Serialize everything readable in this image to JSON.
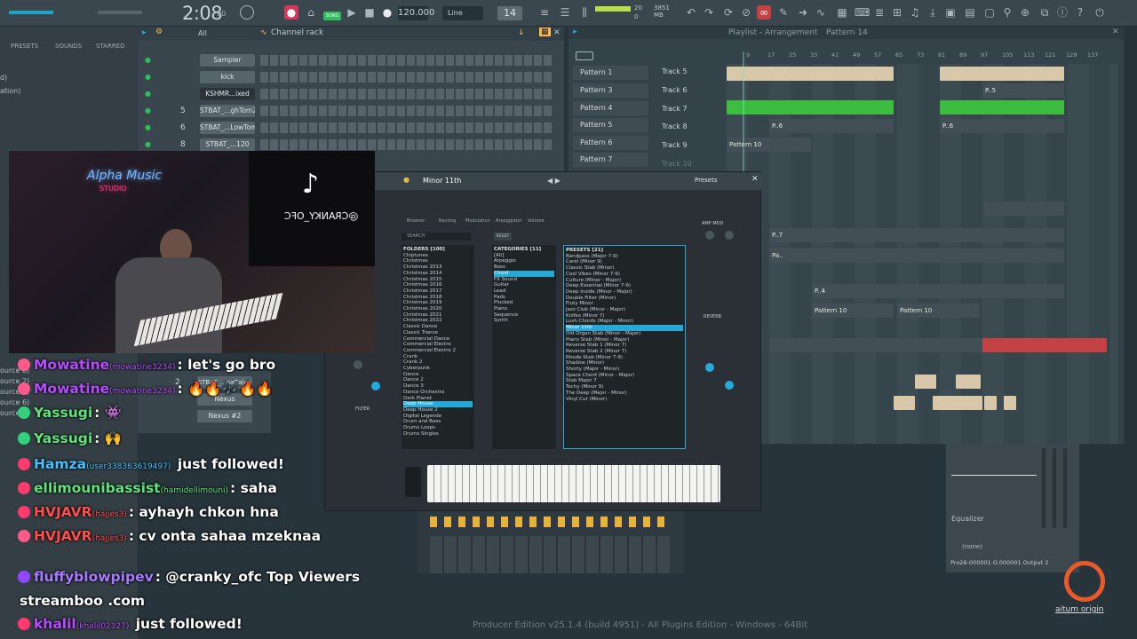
{
  "toolbar": {
    "time": "2:08",
    "time_sub": "00",
    "song_label": "SONG",
    "tempo": "120.000",
    "snap": "Line",
    "steps": "14",
    "cpu": "20",
    "memory": "3851 MB",
    "cpu_row2": "0"
  },
  "browser": {
    "tabs": [
      "PRESETS",
      "SOUNDS",
      "STARRED"
    ],
    "left_items": [
      "d)",
      "ation)",
      "ource 6)",
      "ource 2)",
      "ource 1)",
      "ource 6)",
      "ource 7)"
    ]
  },
  "channel_rack": {
    "filter": "All",
    "title": "Channel rack",
    "channels": [
      {
        "num": "",
        "name": "Sampler"
      },
      {
        "num": "",
        "name": "kick"
      },
      {
        "num": "",
        "name": "KSHMR...ixed"
      },
      {
        "num": "5",
        "name": "STBAT_...ghTom2"
      },
      {
        "num": "6",
        "name": "STBAT_...LowTom"
      },
      {
        "num": "8",
        "name": "STBAT_...120"
      },
      {
        "num": "2",
        "name": "STBAT_...naCajon"
      },
      {
        "num": "",
        "name": "Nexus"
      },
      {
        "num": "",
        "name": "Nexus #2"
      }
    ]
  },
  "playlist": {
    "title": "Playlist - Arrangement",
    "pattern": "Pattern 14",
    "patterns": [
      "Pattern 1",
      "Pattern 3",
      "Pattern 4",
      "Pattern 5",
      "Pattern 6",
      "Pattern 7"
    ],
    "tracks": [
      "Track 5",
      "Track 6",
      "Track 7",
      "Track 8",
      "Track 9",
      "Track 10"
    ],
    "ruler": [
      "9",
      "17",
      "25",
      "33",
      "41",
      "49",
      "57",
      "65",
      "73",
      "81",
      "89",
      "97",
      "105",
      "113",
      "121",
      "129",
      "137"
    ],
    "clip_labels": {
      "p5": "P..5",
      "p6": "P..6",
      "pattern10": "Pattern 10",
      "p7": "P..7",
      "pa": "Pa..",
      "p4": "P..4"
    }
  },
  "plugin": {
    "preset": "Minor 11th",
    "presets_label": "Presets",
    "tabs": [
      "Browser",
      "Routing",
      "Modulation",
      "Arpeggiator",
      "Volume"
    ],
    "folders_title": "FOLDERS [100]",
    "folders": [
      "Chiptunes",
      "Christmas",
      "Christmas 2013",
      "Christmas 2014",
      "Christmas 2015",
      "Christmas 2016",
      "Christmas 2017",
      "Christmas 2018",
      "Christmas 2019",
      "Christmas 2020",
      "Christmas 2021",
      "Christmas 2022",
      "Classic Dance",
      "Classic Trance",
      "Commercial Dance",
      "Commercial Electro",
      "Commercial Electro 2",
      "Crank",
      "Crank 2",
      "Cyberpunk",
      "Dance",
      "Dance 2",
      "Dance 3",
      "Dance Orchestra",
      "Dark Planet",
      "Deep House",
      "Deep House 2",
      "Digital Legende",
      "Drum and Bass",
      "Drums Loops",
      "Drums Singles"
    ],
    "categories_title": "CATEGORIES [11]",
    "categories": [
      "[All]",
      "Arpeggio",
      "Bass",
      "Chord",
      "FX Sound",
      "Guitar",
      "Lead",
      "Pads",
      "Plucked",
      "Piano",
      "Sequence",
      "Synth"
    ],
    "presets_title": "PRESETS [21]",
    "presets": [
      "Bandpass (Major 7-9)",
      "Carol (Minor 9)",
      "Classic Stab (Minor)",
      "Cool Vibes (Minor 7-9)",
      "Culture (Minor - Major)",
      "Deep Essential (Minor 7-9)",
      "Deep Inside (Minor - Major)",
      "Double Filter (Minor)",
      "Fluty Minor",
      "Jazz Club (Minor - Major)",
      "Knifes (Minor 7)",
      "Lush Chords (Major - Minor)",
      "Minor 11th",
      "Old Organ Stab (Minor - Major)",
      "Piano Stab (Minor - Major)",
      "Reverse Stab 1 (Minor 7)",
      "Reverse Stab 2 (Minor 7)",
      "Rhode Stab (Minor 7-9)",
      "Shadow (Minor)",
      "Shorty (Major - Minor)",
      "Space Chord (Minor - Major)",
      "Stab Major 7",
      "Techy (Minor 9)",
      "The Deep (Major - Minor)",
      "Vinyl Cut (Minor)"
    ],
    "amp_mod": "AMP MOD",
    "reverb": "REVERB",
    "filter": "FILTER",
    "search": "SEARCH",
    "reset": "RESET"
  },
  "webcam": {
    "studio_name": "Alpha Music",
    "studio_sub": "STUDIO",
    "tiktok_handle": "@CRANKY_OFC"
  },
  "chat": [
    {
      "name": "Mowatine",
      "sub": "(mowatine3234)",
      "msg": ": let's go bro",
      "color": "#b64cff",
      "badge": "#ff5a8a"
    },
    {
      "name": "Mowatine",
      "sub": "(mowatine3234)",
      "msg": ": 🔥🔥🎶🔥🔥",
      "color": "#b64cff",
      "badge": "#ff5a8a"
    },
    {
      "name": "Yassugi",
      "sub": "",
      "msg": ": 👾",
      "color": "#5fe37a",
      "badge": "#33d17a"
    },
    {
      "name": "Yassugi",
      "sub": "",
      "msg": ": 🙌",
      "color": "#5fe37a",
      "badge": "#33d17a"
    },
    {
      "name": "Hamza",
      "sub": "(user338363619497)",
      "msg": " just followed!",
      "color": "#47c0ff",
      "badge": "#ff3a6e"
    },
    {
      "name": "ellimounibassist",
      "sub": "(hamidellimouni)",
      "msg": ": saha",
      "color": "#5fe37a",
      "badge": "#ff3a6e"
    },
    {
      "name": "HVJAVR",
      "sub": "(hajjes3)",
      "msg": ": ayhayh chkon hna",
      "color": "#ff4d4d",
      "badge": "#ff3a6e"
    },
    {
      "name": "HVJAVR",
      "sub": "(hajjes3)",
      "msg": ": cv onta sahaa mzeknaa",
      "color": "#ff4d4d",
      "badge": "#ff5a8a"
    },
    {
      "name": "fluffyblowpipev",
      "sub": "",
      "msg": ": @cranky_ofc Top Viewers",
      "color": "#a77bff",
      "badge": "#9146ff"
    },
    {
      "name": "",
      "sub": "",
      "msg": "streamboo .com",
      "color": "#ffffff",
      "badge": ""
    },
    {
      "name": "khalil",
      "sub": "(khalil02327)",
      "msg": " just followed!",
      "color": "#b64cff",
      "badge": "#ff3a6e"
    }
  ],
  "equalizer": {
    "label": "Equalizer",
    "none": "(none)",
    "program": "Pro26-000001 O.000001 Output 2"
  },
  "footer": "Producer Edition v25.1.4 (build 4951) - All Plugins Edition - Windows - 64Bit",
  "logo_text": "aitum origin",
  "colors": {
    "accent": "#24a9d8",
    "clip_beige": "#d8c7a8",
    "clip_green": "#3dbd3f",
    "clip_red": "#c54244"
  }
}
